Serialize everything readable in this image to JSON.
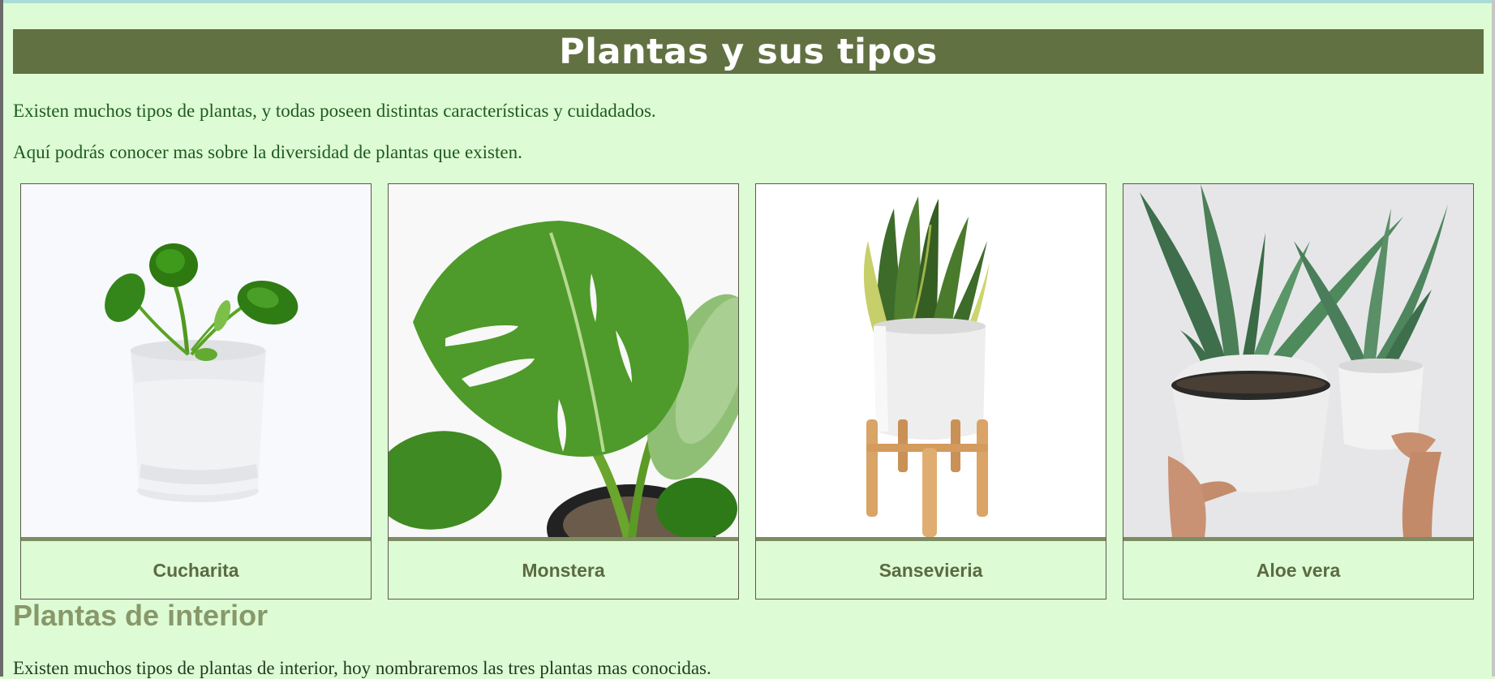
{
  "header": {
    "title": "Plantas y sus tipos"
  },
  "intro": {
    "p1": "Existen muchos tipos de plantas, y todas poseen distintas características y cuidadados.",
    "p2": "Aquí podrás conocer mas sobre la diversidad de plantas que existen."
  },
  "cards": [
    {
      "name": "Cucharita"
    },
    {
      "name": "Monstera"
    },
    {
      "name": "Sansevieria"
    },
    {
      "name": "Aloe vera"
    }
  ],
  "section": {
    "title": "Plantas de interior",
    "text": "Existen muchos tipos de plantas de interior, hoy nombraremos las tres plantas mas conocidas."
  },
  "colors": {
    "background": "#ddfcd5",
    "header_bg": "#627141",
    "card_label": "#5c6a42",
    "section_title": "#88986a"
  }
}
